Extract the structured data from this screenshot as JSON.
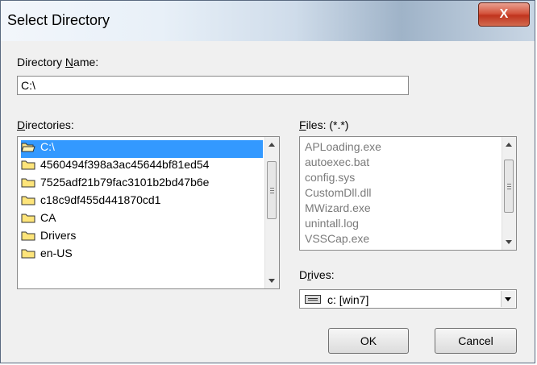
{
  "window": {
    "title": "Select Directory",
    "close_label": "X"
  },
  "directory_name": {
    "label_prefix": "Directory ",
    "label_accel": "N",
    "label_suffix": "ame:",
    "value": "C:\\"
  },
  "directories": {
    "label_accel": "D",
    "label_suffix": "irectories:",
    "items": [
      {
        "label": "C:\\",
        "icon": "open-folder-icon",
        "selected": true
      },
      {
        "label": "4560494f398a3ac45644bf81ed54",
        "icon": "folder-icon"
      },
      {
        "label": "7525adf21b79fac3101b2bd47b6e",
        "icon": "folder-icon"
      },
      {
        "label": "c18c9df455d441870cd1",
        "icon": "folder-icon"
      },
      {
        "label": "CA",
        "icon": "folder-icon"
      },
      {
        "label": "Drivers",
        "icon": "folder-icon"
      },
      {
        "label": "en-US",
        "icon": "folder-icon"
      }
    ]
  },
  "files": {
    "label_accel": "F",
    "label_suffix": "iles: (*.*)",
    "items": [
      "APLoading.exe",
      "autoexec.bat",
      "config.sys",
      "CustomDll.dll",
      "MWizard.exe",
      "unintall.log",
      "VSSCap.exe"
    ]
  },
  "drives": {
    "label_prefix": "D",
    "label_accel": "r",
    "label_suffix": "ives:",
    "value": "c: [win7]",
    "icon": "drive-icon"
  },
  "buttons": {
    "ok": "OK",
    "cancel": "Cancel"
  },
  "colors": {
    "selection": "#3399ff",
    "close": "#c0341e"
  }
}
